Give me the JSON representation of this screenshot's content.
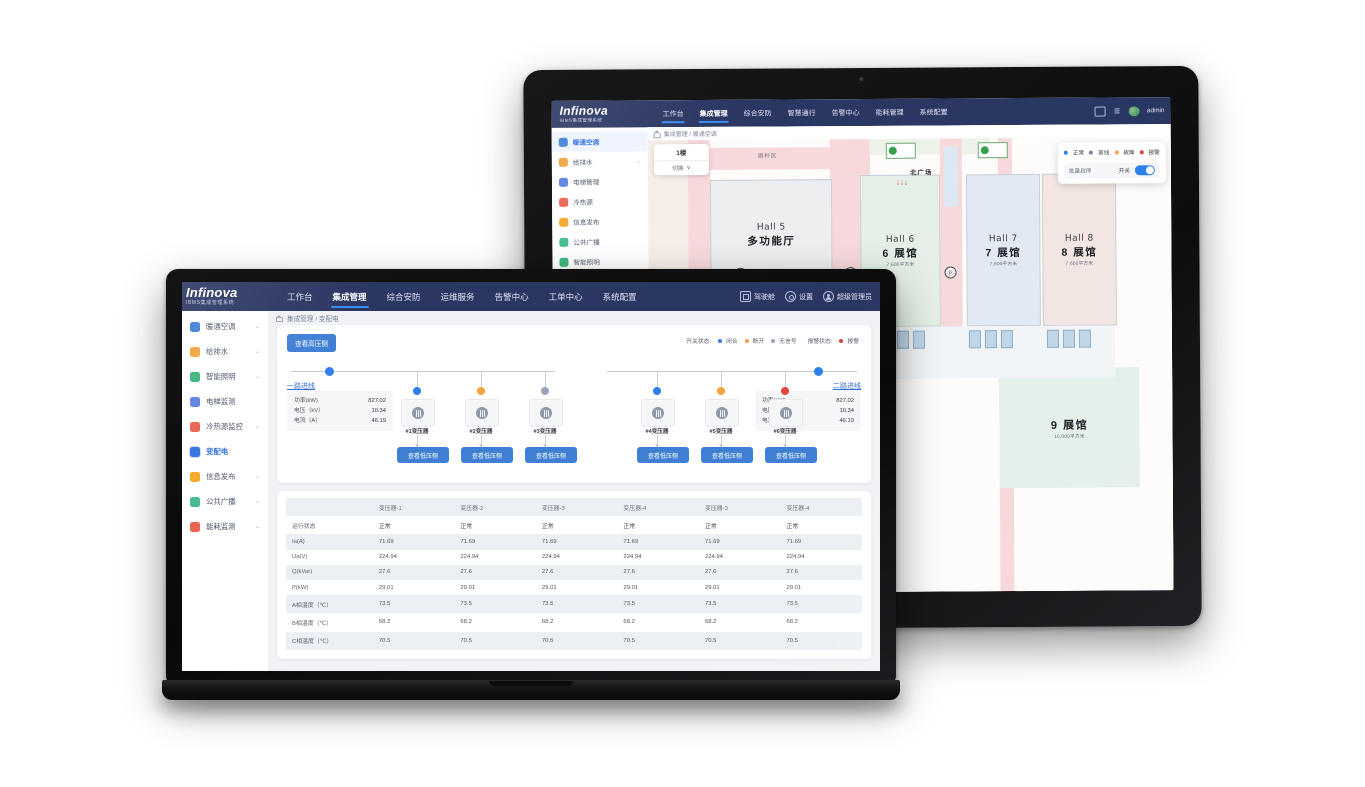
{
  "brand": {
    "name": "Infinova",
    "subtitle": "IBMS集成管理系统"
  },
  "tablet": {
    "nav": [
      {
        "label": "工作台",
        "active": false
      },
      {
        "label": "集成管理",
        "active": true
      },
      {
        "label": "综合安防",
        "active": false
      },
      {
        "label": "智慧通行",
        "active": false
      },
      {
        "label": "告警中心",
        "active": false
      },
      {
        "label": "能耗管理",
        "active": false
      },
      {
        "label": "系统配置",
        "active": false
      }
    ],
    "user": "admin",
    "breadcrumb": "集成管理 / 暖通空调",
    "sidebar": [
      {
        "label": "暖通空调",
        "color": "#3f7fd4",
        "chevron": "",
        "active": true
      },
      {
        "label": "给排水",
        "color": "#f2a33c",
        "chevron": "⌄",
        "active": false
      },
      {
        "label": "电梯管理",
        "color": "#5b7fe0",
        "chevron": "",
        "active": false
      },
      {
        "label": "冷热源",
        "color": "#e8604c",
        "chevron": "",
        "active": false
      },
      {
        "label": "信息发布",
        "color": "#f5a623",
        "chevron": "",
        "active": false
      },
      {
        "label": "公共广播",
        "color": "#3fb98b",
        "chevron": "",
        "active": false
      },
      {
        "label": "智能照明",
        "color": "#34b37a",
        "chevron": "",
        "active": false
      }
    ],
    "floor_selector": {
      "floor": "1楼",
      "switch_label": "切换",
      "chevron": "∨"
    },
    "legend": [
      {
        "label": "正常",
        "color": "#2f80ed"
      },
      {
        "label": "离线",
        "color": "#7b8495"
      },
      {
        "label": "故障",
        "color": "#f2a33c"
      },
      {
        "label": "报警",
        "color": "#e0453c"
      }
    ],
    "batch": {
      "title": "批量启停",
      "switch_label": "开关",
      "state": "on"
    },
    "map": {
      "zones": [
        {
          "label": "旗杆区"
        },
        {
          "label": "北广场"
        }
      ],
      "halls": [
        {
          "en": "Hall 5",
          "cn": "多功能厅",
          "size": ""
        },
        {
          "en": "Hall 6",
          "cn": "6 展馆",
          "size": "7,600平方米"
        },
        {
          "en": "Hall 7",
          "cn": "7 展馆",
          "size": "7,600平方米"
        },
        {
          "en": "Hall 8",
          "cn": "8 展馆",
          "size": "7,600平方米"
        },
        {
          "en": "",
          "cn": "9 展馆",
          "size": "15,000平方米"
        }
      ],
      "markers": {
        "parking": "Ⓟ",
        "vip": "VIP",
        "exit": "口"
      }
    }
  },
  "laptop": {
    "nav": [
      {
        "label": "工作台",
        "active": false
      },
      {
        "label": "集成管理",
        "active": true
      },
      {
        "label": "综合安防",
        "active": false
      },
      {
        "label": "运维服务",
        "active": false
      },
      {
        "label": "告警中心",
        "active": false
      },
      {
        "label": "工单中心",
        "active": false
      },
      {
        "label": "系统配置",
        "active": false
      }
    ],
    "top_right": [
      {
        "label": "驾驶舱",
        "icon": "cockpit-icon"
      },
      {
        "label": "设置",
        "icon": "gear-icon"
      },
      {
        "label": "超级管理员",
        "icon": "user-icon"
      }
    ],
    "breadcrumb": "集成管理 / 变配电",
    "sidebar": [
      {
        "label": "暖通空调",
        "color": "#3f7fd4",
        "chevron": "⌄",
        "active": false
      },
      {
        "label": "给排水",
        "color": "#f2a33c",
        "chevron": "⌄",
        "active": false
      },
      {
        "label": "智能照明",
        "color": "#34b37a",
        "chevron": "⌄",
        "active": false
      },
      {
        "label": "电梯监测",
        "color": "#5b7fe0",
        "chevron": "",
        "active": false
      },
      {
        "label": "冷热源监控",
        "color": "#e8604c",
        "chevron": "⌄",
        "active": false
      },
      {
        "label": "变配电",
        "color": "#2f6fe0",
        "chevron": "",
        "active": true
      },
      {
        "label": "信息发布",
        "color": "#f5a623",
        "chevron": "⌄",
        "active": false
      },
      {
        "label": "公共广播",
        "color": "#3fb98b",
        "chevron": "⌄",
        "active": false
      },
      {
        "label": "能耗监测",
        "color": "#e8604c",
        "chevron": "⌄",
        "active": false
      }
    ],
    "diagram": {
      "hv_button": "查看高压侧",
      "legend": {
        "switch_title": "开关状态:",
        "switch_states": [
          {
            "label": "闭合",
            "color": "#2f80ed"
          },
          {
            "label": "断开",
            "color": "#f2a33c"
          },
          {
            "label": "无信号",
            "color": "#9aa2b5"
          }
        ],
        "alarm_title": "报警状态:",
        "alarm_states": [
          {
            "label": "报警",
            "color": "#e0453c"
          }
        ]
      },
      "feeder_left": "一路进线",
      "feeder_right": "二路进线",
      "panel_left": {
        "rows": [
          {
            "label": "功率(kW)",
            "value": "827.02"
          },
          {
            "label": "电压（kV）",
            "value": "10.34"
          },
          {
            "label": "电流（A）",
            "value": "46.19"
          }
        ]
      },
      "panel_right": {
        "rows": [
          {
            "label": "功率(kW)",
            "value": "827.02"
          },
          {
            "label": "电压（kV）",
            "value": "10.34"
          },
          {
            "label": "电流（A）",
            "value": "46.19"
          }
        ]
      },
      "lv_button": "查看低压侧",
      "transformers": [
        {
          "label": "#1变压器",
          "status_color": "#2f80ed",
          "status": "闭合"
        },
        {
          "label": "#2变压器",
          "status_color": "#f2a33c",
          "status": "断开"
        },
        {
          "label": "#3变压器",
          "status_color": "#9aa2b5",
          "status": "无信号"
        },
        {
          "label": "#4变压器",
          "status_color": "#2f80ed",
          "status": "闭合"
        },
        {
          "label": "#5变压器",
          "status_color": "#f2a33c",
          "status": "断开"
        },
        {
          "label": "#6变压器",
          "status_color": "#e0453c",
          "status": "报警"
        }
      ]
    },
    "table": {
      "columns": [
        "",
        "变压器-1",
        "变压器-2",
        "变压器-3",
        "变压器-4",
        "变压器-3",
        "变压器-4"
      ],
      "rows": [
        {
          "label": "运行状态",
          "values": [
            "正常",
            "正常",
            "正常",
            "正常",
            "正常",
            "正常"
          ]
        },
        {
          "label": "Ia(A)",
          "values": [
            "71.69",
            "71.69",
            "71.69",
            "71.69",
            "71.69",
            "71.69"
          ]
        },
        {
          "label": "Ua(V)",
          "values": [
            "224.94",
            "224.94",
            "224.94",
            "224.94",
            "224.94",
            "224.94"
          ]
        },
        {
          "label": "Q(kVar)",
          "values": [
            "27.6",
            "27.6",
            "27.6",
            "27.6",
            "27.6",
            "27.6"
          ]
        },
        {
          "label": "P(kW)",
          "values": [
            "29.01",
            "29.01",
            "29.01",
            "29.01",
            "29.01",
            "29.01"
          ]
        },
        {
          "label": "A相温度（℃）",
          "values": [
            "73.5",
            "73.5",
            "73.5",
            "73.5",
            "73.5",
            "73.5"
          ]
        },
        {
          "label": "B相温度（℃）",
          "values": [
            "68.2",
            "68.2",
            "68.2",
            "68.2",
            "68.2",
            "68.2"
          ]
        },
        {
          "label": "C相温度（℃）",
          "values": [
            "70.5",
            "70.5",
            "70.5",
            "70.5",
            "70.5",
            "70.5"
          ]
        }
      ]
    }
  }
}
